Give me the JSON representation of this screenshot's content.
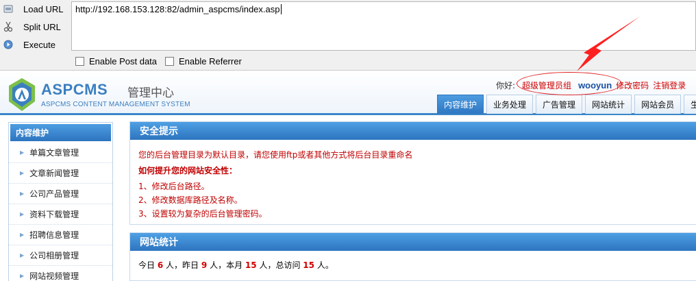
{
  "hackbar": {
    "load_url": "Load URL",
    "split_url": "Split URL",
    "execute": "Execute",
    "url_value": "http://192.168.153.128:82/admin_aspcms/index.asp",
    "enable_post": "Enable Post data",
    "enable_referrer": "Enable Referrer"
  },
  "header": {
    "logo_main": "ASPCMS",
    "logo_cn": "管理中心",
    "logo_sub": "ASPCMS CONTENT MANAGEMENT SYSTEM",
    "greeting": "你好:",
    "group": "超级管理员组",
    "username": "wooyun",
    "change_password": "修改密码",
    "logout": "注销登录",
    "tabs": [
      "内容维护",
      "业务处理",
      "广告管理",
      "网站统计",
      "网站会员",
      "生成"
    ]
  },
  "sidebar": {
    "title": "内容维护",
    "items": [
      "单篇文章管理",
      "文章新闻管理",
      "公司产品管理",
      "资料下载管理",
      "招聘信息管理",
      "公司相册管理",
      "网站视频管理"
    ]
  },
  "security": {
    "title": "安全提示",
    "warning": "您的后台管理目录为默认目录，请您使用ftp或者其他方式将后台目录重命名",
    "howto": "如何提升您的网站安全性：",
    "tips": [
      "1、修改后台路径。",
      "2、修改数据库路径及名称。",
      "3、设置较为复杂的后台管理密码。"
    ]
  },
  "stats": {
    "title": "网站统计",
    "today_label": "今日",
    "today": "6",
    "yesterday_label": "人，昨日",
    "yesterday": "9",
    "month_label": "人，本月",
    "month": "15",
    "total_label": "人，总访问",
    "total": "15",
    "end_label": "人。"
  },
  "colors": {
    "accent_blue": "#2e77c2",
    "warning_red": "#c00000",
    "annotation_red": "#e02020"
  }
}
